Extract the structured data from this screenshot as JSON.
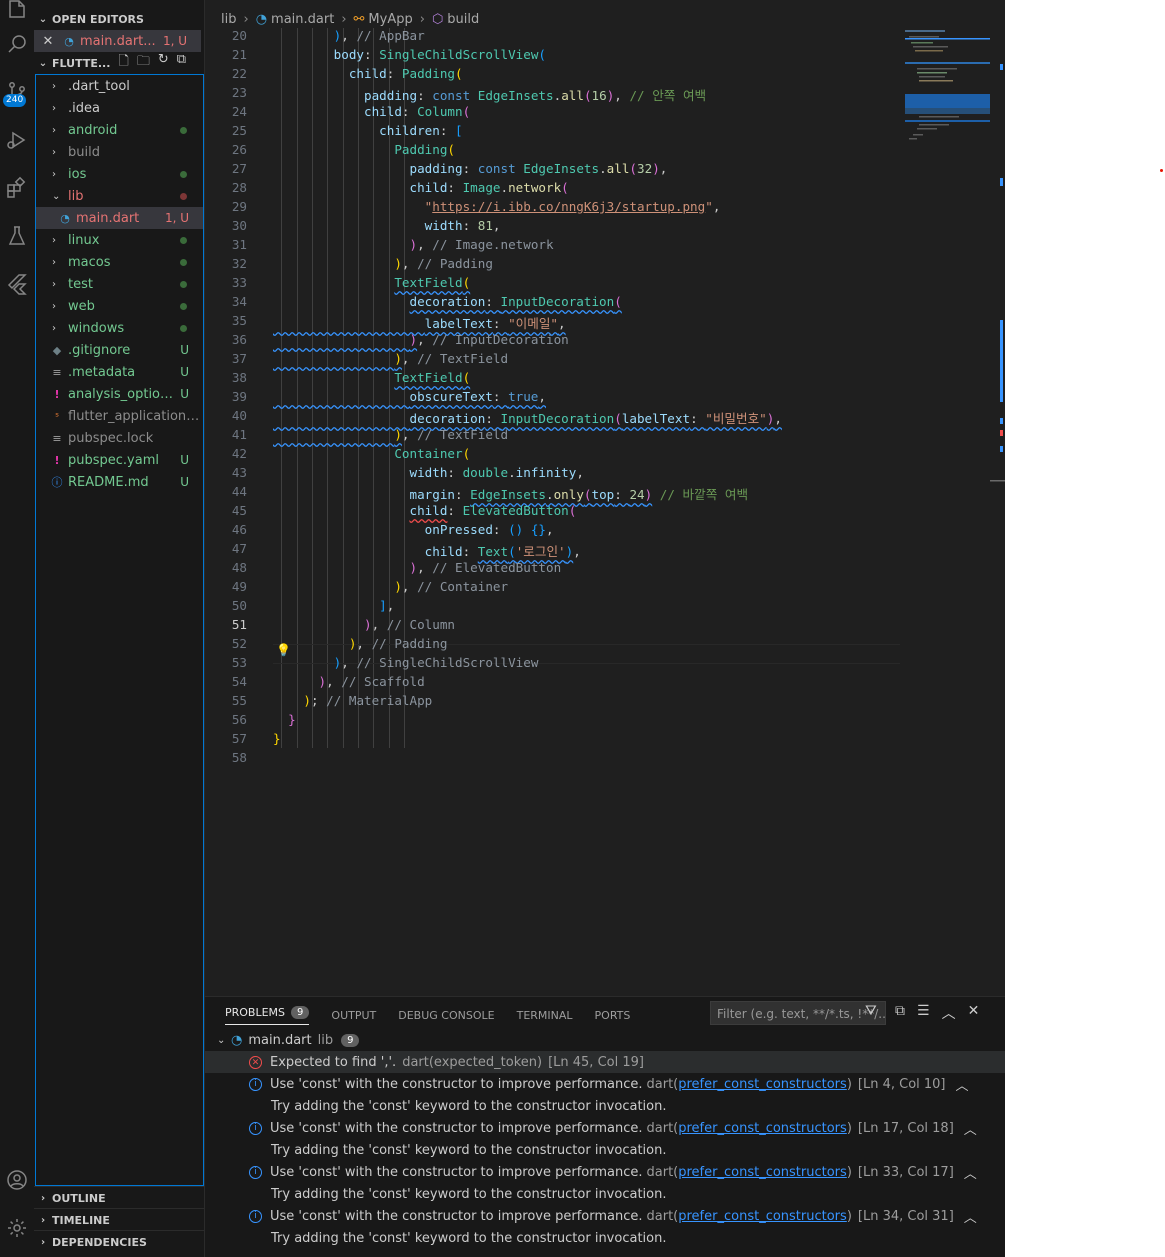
{
  "activity": {
    "badge": "240"
  },
  "sidebar": {
    "open_editors_label": "OPEN EDITORS",
    "open_file": {
      "name": "main.dart...",
      "status": "1, U"
    },
    "folder_label": "FLUTTE...",
    "items": [
      {
        "name": ".dart_tool",
        "status": ""
      },
      {
        "name": ".idea",
        "status": ""
      },
      {
        "name": "android",
        "status": ""
      },
      {
        "name": "build",
        "status": ""
      },
      {
        "name": "ios",
        "status": ""
      },
      {
        "name": "lib",
        "status": ""
      },
      {
        "name": "main.dart",
        "status": "1, U"
      },
      {
        "name": "linux",
        "status": ""
      },
      {
        "name": "macos",
        "status": ""
      },
      {
        "name": "test",
        "status": ""
      },
      {
        "name": "web",
        "status": ""
      },
      {
        "name": "windows",
        "status": ""
      },
      {
        "name": ".gitignore",
        "status": "U"
      },
      {
        "name": ".metadata",
        "status": "U"
      },
      {
        "name": "analysis_options....",
        "status": "U"
      },
      {
        "name": "flutter_application_1.i...",
        "status": ""
      },
      {
        "name": "pubspec.lock",
        "status": ""
      },
      {
        "name": "pubspec.yaml",
        "status": "U"
      },
      {
        "name": "README.md",
        "status": "U"
      }
    ],
    "outline_label": "OUTLINE",
    "timeline_label": "TIMELINE",
    "dependencies_label": "DEPENDENCIES"
  },
  "breadcrumb": {
    "folder": "lib",
    "file": "main.dart",
    "class": "MyApp",
    "method": "build"
  },
  "editor": {
    "line_numbers": [
      "20",
      "21",
      "22",
      "23",
      "24",
      "25",
      "26",
      "27",
      "28",
      "29",
      "30",
      "31",
      "32",
      "33",
      "34",
      "35",
      "36",
      "37",
      "38",
      "39",
      "40",
      "41",
      "42",
      "43",
      "44",
      "45",
      "46",
      "47",
      "48",
      "49",
      "50",
      "51",
      "52",
      "53",
      "54",
      "55",
      "56",
      "57",
      "58"
    ],
    "current_line": "51"
  },
  "panel": {
    "tabs": {
      "problems": "PROBLEMS",
      "problems_count": "9",
      "output": "OUTPUT",
      "debug": "DEBUG CONSOLE",
      "terminal": "TERMINAL",
      "ports": "PORTS"
    },
    "filter_placeholder": "Filter (e.g. text, **/*.ts, !**/...",
    "file": {
      "name": "main.dart",
      "folder": "lib",
      "count": "9"
    },
    "problems": [
      {
        "severity": "error",
        "message": "Expected to find ','.",
        "source": "dart(expected_token)",
        "code": "",
        "location": "[Ln 45, Col 19]",
        "hint": ""
      },
      {
        "severity": "info",
        "message": "Use 'const' with the constructor to improve performance.",
        "source": "dart",
        "code": "prefer_const_constructors",
        "location": "[Ln 4, Col 10]",
        "hint": "Try adding the 'const' keyword to the constructor invocation."
      },
      {
        "severity": "info",
        "message": "Use 'const' with the constructor to improve performance.",
        "source": "dart",
        "code": "prefer_const_constructors",
        "location": "[Ln 17, Col 18]",
        "hint": "Try adding the 'const' keyword to the constructor invocation."
      },
      {
        "severity": "info",
        "message": "Use 'const' with the constructor to improve performance.",
        "source": "dart",
        "code": "prefer_const_constructors",
        "location": "[Ln 33, Col 17]",
        "hint": "Try adding the 'const' keyword to the constructor invocation."
      },
      {
        "severity": "info",
        "message": "Use 'const' with the constructor to improve performance.",
        "source": "dart",
        "code": "prefer_const_constructors",
        "location": "[Ln 34, Col 31]",
        "hint": "Try adding the 'const' keyword to the constructor invocation."
      }
    ]
  },
  "colors": {
    "accent": "#0078d4",
    "error": "#f14c4c",
    "info": "#3794ff",
    "git_modified": "#e2c08d",
    "git_untracked": "#73c991"
  }
}
